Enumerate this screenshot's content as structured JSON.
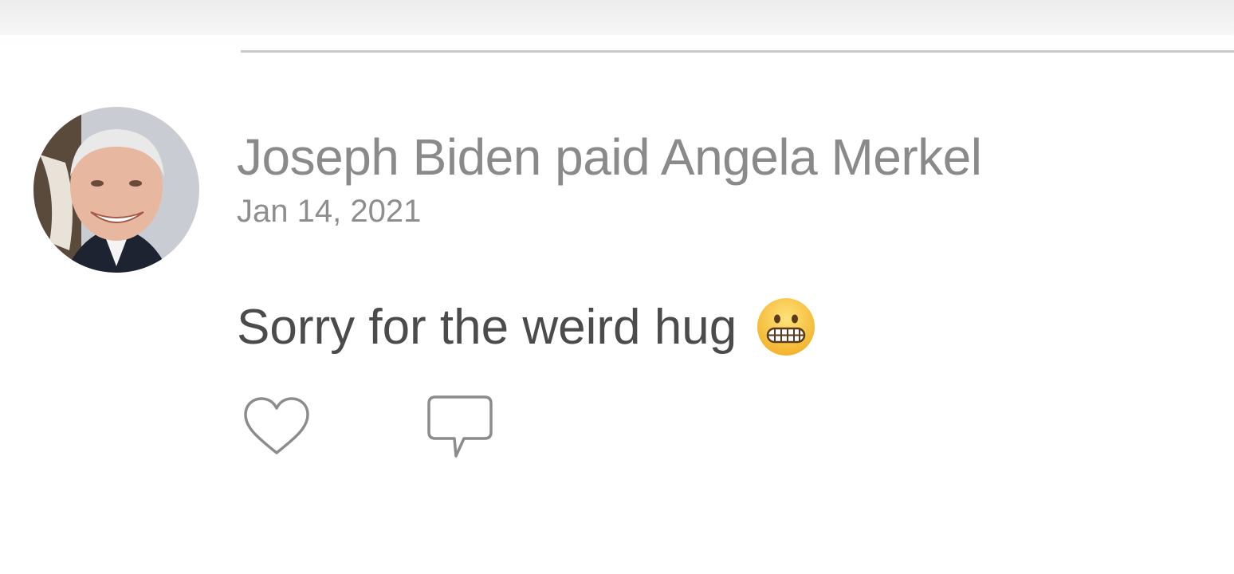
{
  "feed_item": {
    "title": "Joseph Biden paid Angela Merkel",
    "date": "Jan 14, 2021",
    "note": "Sorry for the weird hug",
    "emoji_icon": "grimacing-face-icon"
  },
  "actions": {
    "like_icon": "heart-icon",
    "comment_icon": "comment-icon"
  },
  "colors": {
    "title": "#8a8a8a",
    "date": "#8e8e8e",
    "note": "#4b4b4b",
    "icon_stroke": "#8c8c8c",
    "separator": "#c9c9c9"
  }
}
